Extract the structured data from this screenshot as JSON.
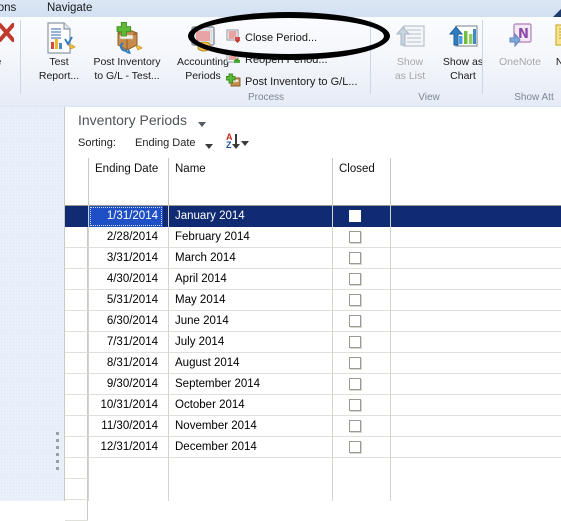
{
  "menubar": {
    "items": [
      {
        "label": "tions",
        "name": "menu-actions"
      },
      {
        "label": "Navigate",
        "name": "menu-navigate"
      }
    ]
  },
  "ribbon": {
    "groups": [
      {
        "label": "Process"
      },
      {
        "label": "View"
      },
      {
        "label": "Show Att"
      }
    ],
    "buttons": {
      "delete_partial": "te",
      "test_report_l1": "Test",
      "test_report_l2": "Report...",
      "post_inventory_gl_test_l1": "Post Inventory",
      "post_inventory_gl_test_l2": "to G/L - Test...",
      "accounting_periods_l1": "Accounting",
      "accounting_periods_l2": "Periods",
      "close_period": "Close Period...",
      "reopen_period": "Reopen Period...",
      "post_inventory_to_gl": "Post Inventory to G/L...",
      "show_as_list_l1": "Show",
      "show_as_list_l2": "as List",
      "show_as_chart_l1": "Show as",
      "show_as_chart_l2": "Chart",
      "onenote": "OneNote",
      "notes_partial": "Note"
    },
    "icons": {
      "delete": "delete-x-icon",
      "test_report": "report-chart-icon",
      "post_inventory_gl_test": "box-package-icon",
      "accounting_periods": "calendar-periods-icon",
      "close_period": "close-period-icon",
      "reopen_period": "reopen-period-icon",
      "post_inventory_to_gl": "post-inventory-icon",
      "show_as_list": "list-view-icon",
      "show_as_chart": "bar-chart-icon",
      "onenote": "onenote-icon",
      "notes": "sticky-note-icon"
    }
  },
  "annotation": {
    "shape": "ellipse-highlight",
    "color": "#000000"
  },
  "list": {
    "title": "Inventory Periods",
    "sorting_label": "Sorting:",
    "sorting_field": "Ending Date",
    "sort_direction_icon": "sort-az-ascending-icon"
  },
  "grid": {
    "columns": [
      {
        "label": "Ending Date"
      },
      {
        "label": "Name"
      },
      {
        "label": "Closed"
      },
      {
        "label": ""
      }
    ],
    "rows": [
      {
        "ending_date": "1/31/2014",
        "name": "January 2014",
        "closed": false,
        "selected": true
      },
      {
        "ending_date": "2/28/2014",
        "name": "February 2014",
        "closed": false,
        "selected": false
      },
      {
        "ending_date": "3/31/2014",
        "name": "March 2014",
        "closed": false,
        "selected": false
      },
      {
        "ending_date": "4/30/2014",
        "name": "April 2014",
        "closed": false,
        "selected": false
      },
      {
        "ending_date": "5/31/2014",
        "name": "May 2014",
        "closed": false,
        "selected": false
      },
      {
        "ending_date": "6/30/2014",
        "name": "June 2014",
        "closed": false,
        "selected": false
      },
      {
        "ending_date": "7/31/2014",
        "name": "July 2014",
        "closed": false,
        "selected": false
      },
      {
        "ending_date": "8/31/2014",
        "name": "August 2014",
        "closed": false,
        "selected": false
      },
      {
        "ending_date": "9/30/2014",
        "name": "September 2014",
        "closed": false,
        "selected": false
      },
      {
        "ending_date": "10/31/2014",
        "name": "October 2014",
        "closed": false,
        "selected": false
      },
      {
        "ending_date": "11/30/2014",
        "name": "November 2014",
        "closed": false,
        "selected": false
      },
      {
        "ending_date": "12/31/2014",
        "name": "December 2014",
        "closed": false,
        "selected": false
      }
    ]
  },
  "colors": {
    "selection": "#102b72",
    "selected_cell": "#1f4fc4",
    "ribbon_bg": "#f2f5fa",
    "menubar_bg": "#d8e4f3",
    "left_pane": "#eaf0fa"
  }
}
